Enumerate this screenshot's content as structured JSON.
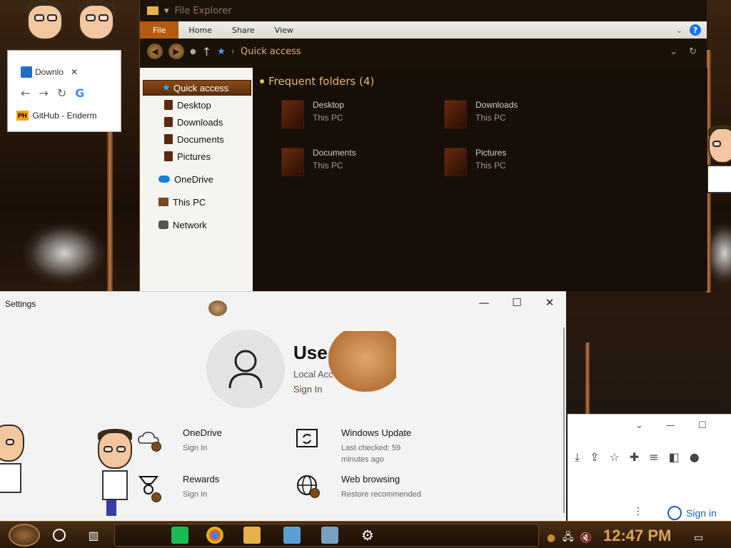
{
  "chrome_bg": {
    "tab_title": "Downlo",
    "bookmark_label": "GitHub - Enderm",
    "bookmark_icon_text": "PH"
  },
  "explorer": {
    "title": "File Explorer",
    "ribbon": {
      "file": "File",
      "home": "Home",
      "share": "Share",
      "view": "View",
      "help": "?"
    },
    "address": "Quick access",
    "nav": {
      "quick_access": "Quick access",
      "items": [
        "Desktop",
        "Downloads",
        "Documents",
        "Pictures"
      ],
      "onedrive": "OneDrive",
      "this_pc": "This PC",
      "network": "Network"
    },
    "group_header": "Frequent folders (4)",
    "folders": [
      {
        "name": "Desktop",
        "location": "This PC"
      },
      {
        "name": "Downloads",
        "location": "This PC"
      },
      {
        "name": "Documents",
        "location": "This PC"
      },
      {
        "name": "Pictures",
        "location": "This PC"
      }
    ]
  },
  "settings": {
    "title": "Settings",
    "user_name": "Use",
    "user_type": "Local Acc",
    "sign_in": "Sign In",
    "tiles": [
      {
        "name": "OneDrive",
        "sub": "Sign In",
        "icon": "cloud-icon"
      },
      {
        "name": "Windows Update",
        "sub": "Last checked: 59 minutes ago",
        "icon": "update-icon"
      },
      {
        "name": "Rewards",
        "sub": "Sign In",
        "icon": "trophy-icon"
      },
      {
        "name": "Web browsing",
        "sub": "Restore recommended",
        "icon": "globe-icon"
      }
    ]
  },
  "chrome_right": {
    "sign_in": "Sign in"
  },
  "taskbar": {
    "clock": "12:47 PM"
  },
  "colors": {
    "accent_brown": "#b35b12",
    "clock_gold": "#d9a35a",
    "qa_blue": "#3fa9f5"
  }
}
